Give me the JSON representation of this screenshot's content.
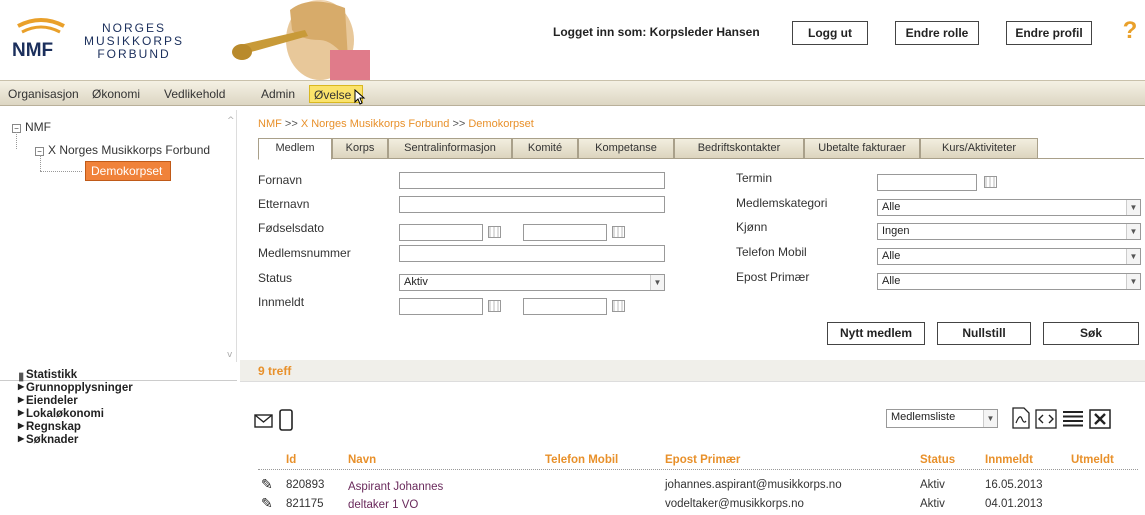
{
  "header": {
    "logo_text": "NMF",
    "org_name": [
      "NORGES",
      "MUSIKKORPS",
      "FORBUND"
    ],
    "logged_in_text": "Logget inn som: Korpsleder Hansen",
    "logout_label": "Logg ut",
    "change_role_label": "Endre rolle",
    "edit_profile_label": "Endre profil",
    "help_label": "?"
  },
  "menu": {
    "items": [
      {
        "label": "Organisasjon"
      },
      {
        "label": "Økonomi"
      },
      {
        "label": "Vedlikehold"
      },
      {
        "label": "Admin"
      },
      {
        "label": "Øvelse"
      }
    ],
    "active": "Øvelse"
  },
  "tree": {
    "root": "NMF",
    "child": "X Norges Musikkorps Forbund",
    "selected": "Demokorpset"
  },
  "sidenav": {
    "items": [
      {
        "label": "Statistikk"
      },
      {
        "label": "Grunnopplysninger"
      },
      {
        "label": "Eiendeler"
      },
      {
        "label": "Lokaløkonomi"
      },
      {
        "label": "Regnskap"
      },
      {
        "label": "Søknader"
      }
    ]
  },
  "breadcrumb": {
    "items": [
      "NMF",
      "X Norges Musikkorps Forbund",
      "Demokorpset"
    ],
    "separator": ">>"
  },
  "tabs": [
    {
      "label": "Medlem"
    },
    {
      "label": "Korps"
    },
    {
      "label": "Sentralinformasjon"
    },
    {
      "label": "Komité"
    },
    {
      "label": "Kompetanse"
    },
    {
      "label": "Bedriftskontakter"
    },
    {
      "label": "Ubetalte fakturaer"
    },
    {
      "label": "Kurs/Aktiviteter"
    }
  ],
  "form": {
    "fornavn_label": "Fornavn",
    "etternavn_label": "Etternavn",
    "fodselsdato_label": "Fødselsdato",
    "medlemsnummer_label": "Medlemsnummer",
    "status_label": "Status",
    "status_value": "Aktiv",
    "innmeldt_label": "Innmeldt",
    "termin_label": "Termin",
    "medlemskategori_label": "Medlemskategori",
    "medlemskategori_value": "Alle",
    "kjonn_label": "Kjønn",
    "kjonn_value": "Ingen",
    "telefon_label": "Telefon Mobil",
    "telefon_value": "Alle",
    "epost_label": "Epost Primær",
    "epost_value": "Alle"
  },
  "actions": {
    "new_member": "Nytt medlem",
    "reset": "Nullstill",
    "search": "Søk"
  },
  "results": {
    "count_text": "9 treff",
    "list_select_value": "Medlemsliste"
  },
  "table": {
    "headers": [
      "Id",
      "Navn",
      "Telefon Mobil",
      "Epost Primær",
      "Status",
      "Innmeldt",
      "Utmeldt"
    ],
    "rows": [
      {
        "id": "820893",
        "name": "Aspirant Johannes",
        "phone": "",
        "email": "johannes.aspirant@musikkorps.no",
        "status": "Aktiv",
        "joined": "16.05.2013",
        "left": ""
      },
      {
        "id": "821175",
        "name": "deltaker 1 VO",
        "phone": "",
        "email": "vodeltaker@musikkorps.no",
        "status": "Aktiv",
        "joined": "04.01.2013",
        "left": ""
      }
    ]
  },
  "colors": {
    "accent_orange": "#e8902a",
    "navy": "#1b2f5c",
    "menu_active": "#fbe36b",
    "tree_selected": "#f0823a"
  }
}
